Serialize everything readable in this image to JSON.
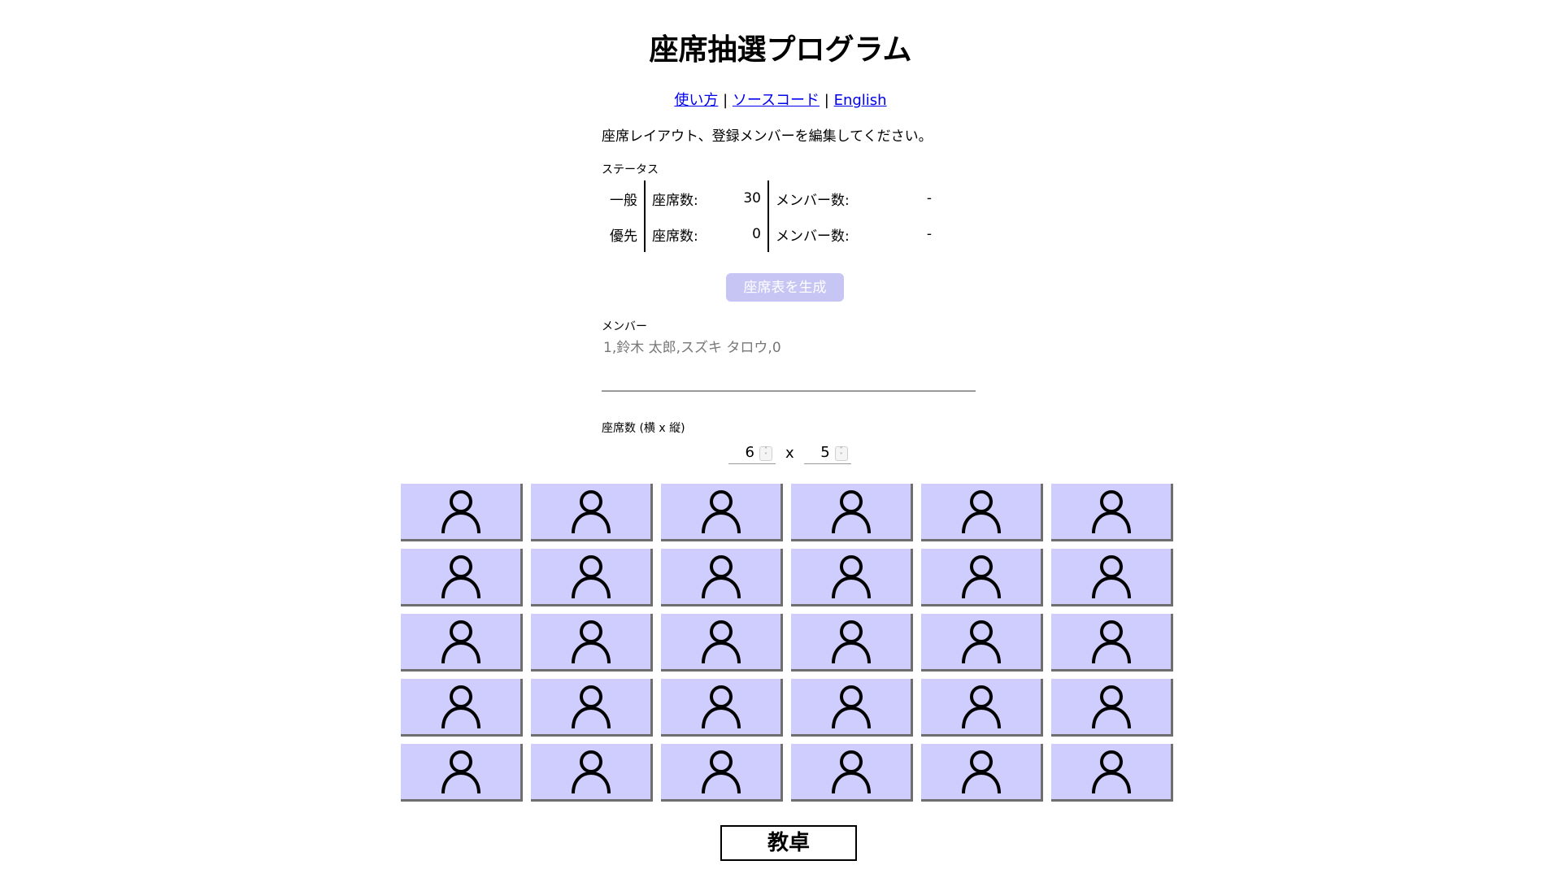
{
  "title": "座席抽選プログラム",
  "links": {
    "usage": "使い方",
    "source": "ソースコード",
    "english": "English",
    "separator": "|"
  },
  "instruction": "座席レイアウト、登録メンバーを編集してください。",
  "status": {
    "label": "ステータス",
    "rows": [
      {
        "category": "一般",
        "seats_label": "座席数:",
        "seats_value": "30",
        "members_label": "メンバー数:",
        "members_value": "-"
      },
      {
        "category": "優先",
        "seats_label": "座席数:",
        "seats_value": "0",
        "members_label": "メンバー数:",
        "members_value": "-"
      }
    ]
  },
  "generate_button": "座席表を生成",
  "members": {
    "label": "メンバー",
    "placeholder": "1,鈴木 太郎,スズキ タロウ,0"
  },
  "seat_size": {
    "label": "座席数 (横 x 縦)",
    "columns": "6",
    "rows": "5",
    "times": "x"
  },
  "seat_grid": {
    "columns": 6,
    "rows": 5,
    "seat_icon": "person-icon",
    "seat_color": "#cfcdfe"
  },
  "desk_label": "教卓",
  "colors": {
    "link": "#0000ee",
    "button_disabled": "#c7c5f4",
    "seat": "#cfcdfe"
  }
}
